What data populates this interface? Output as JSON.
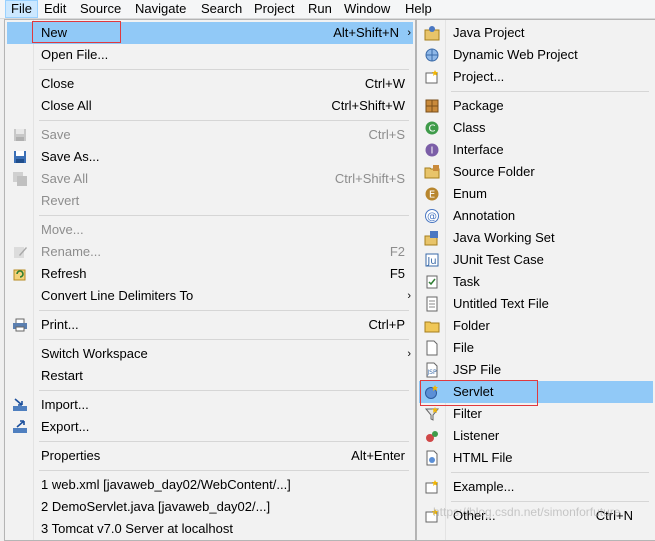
{
  "menubar": [
    "File",
    "Edit",
    "Source",
    "Navigate",
    "Search",
    "Project",
    "Run",
    "Window",
    "Help"
  ],
  "file_menu": {
    "new": {
      "label": "New",
      "accel": "Alt+Shift+N"
    },
    "open_file": "Open File...",
    "close": {
      "label": "Close",
      "accel": "Ctrl+W"
    },
    "close_all": {
      "label": "Close All",
      "accel": "Ctrl+Shift+W"
    },
    "save": {
      "label": "Save",
      "accel": "Ctrl+S"
    },
    "save_as": "Save As...",
    "save_all": {
      "label": "Save All",
      "accel": "Ctrl+Shift+S"
    },
    "revert": "Revert",
    "move": "Move...",
    "rename": {
      "label": "Rename...",
      "accel": "F2"
    },
    "refresh": {
      "label": "Refresh",
      "accel": "F5"
    },
    "convert": "Convert Line Delimiters To",
    "print": {
      "label": "Print...",
      "accel": "Ctrl+P"
    },
    "switch_workspace": "Switch Workspace",
    "restart": "Restart",
    "import": "Import...",
    "export": "Export...",
    "properties": {
      "label": "Properties",
      "accel": "Alt+Enter"
    },
    "recent": [
      "1 web.xml  [javaweb_day02/WebContent/...]",
      "2 DemoServlet.java  [javaweb_day02/...]",
      "3 Tomcat v7.0 Server at localhost"
    ]
  },
  "new_submenu": {
    "java_project": "Java Project",
    "dynamic_web_project": "Dynamic Web Project",
    "project": "Project...",
    "package": "Package",
    "class": "Class",
    "interface": "Interface",
    "source_folder": "Source Folder",
    "enum": "Enum",
    "annotation": "Annotation",
    "java_working_set": "Java Working Set",
    "junit_test_case": "JUnit Test Case",
    "task": "Task",
    "untitled_text_file": "Untitled Text File",
    "folder": "Folder",
    "file": "File",
    "jsp_file": "JSP File",
    "servlet": "Servlet",
    "filter": "Filter",
    "listener": "Listener",
    "html_file": "HTML File",
    "example": "Example...",
    "other": {
      "label": "Other...",
      "accel": "Ctrl+N"
    }
  },
  "watermark": "https://blog.csdn.net/simonforfuture"
}
